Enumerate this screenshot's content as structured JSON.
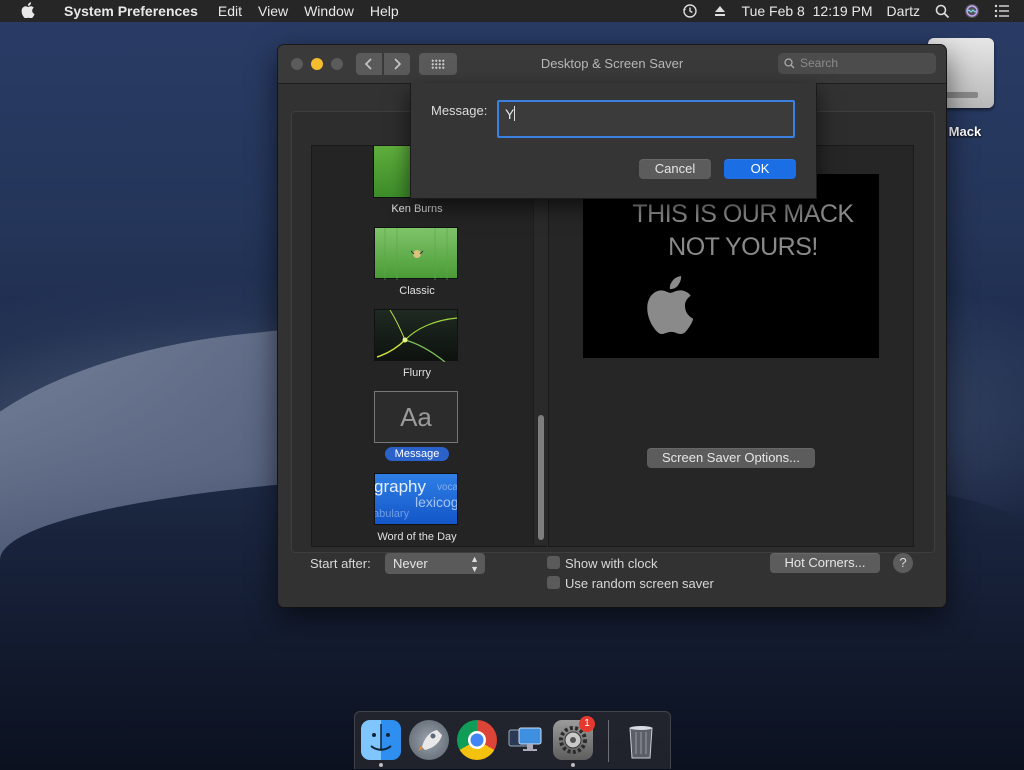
{
  "menubar": {
    "app_name": "System Preferences",
    "menus": [
      "Edit",
      "View",
      "Window",
      "Help"
    ],
    "clock": "Tue Feb 8  12:19 PM",
    "user": "Dartz"
  },
  "desktop": {
    "drive_label": "r Mack"
  },
  "window": {
    "title": "Desktop & Screen Saver",
    "search_placeholder": "Search"
  },
  "screen_savers": [
    {
      "label": "Ken Burns",
      "selected": false
    },
    {
      "label": "Classic",
      "selected": false
    },
    {
      "label": "Flurry",
      "selected": false
    },
    {
      "label": "Message",
      "selected": true,
      "thumb_text": "Aa"
    },
    {
      "label": "Word of the Day",
      "selected": false,
      "thumb_words": [
        "graphy",
        "lexicog",
        "vocab",
        "abulary"
      ]
    }
  ],
  "preview": {
    "message_line1": "THIS IS OUR MACK",
    "message_line2": "NOT YOURS!"
  },
  "buttons": {
    "screen_saver_options": "Screen Saver Options...",
    "hot_corners": "Hot Corners...",
    "help": "?"
  },
  "bottom": {
    "start_after_label": "Start after:",
    "start_after_value": "Never",
    "show_with_clock": "Show with clock",
    "use_random": "Use random screen saver"
  },
  "dialog": {
    "label": "Message:",
    "value": "Y",
    "cancel": "Cancel",
    "ok": "OK"
  },
  "dock": {
    "system_prefs_badge": "1"
  },
  "colors": {
    "accent_blue": "#1c6ee4",
    "selection_blue": "#2a62c9",
    "badge_red": "#e5392f"
  }
}
